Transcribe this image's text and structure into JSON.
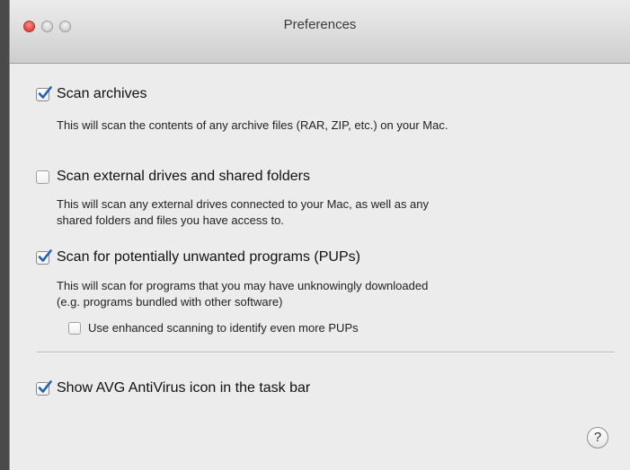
{
  "window": {
    "title": "Preferences"
  },
  "options": [
    {
      "label": "Scan archives",
      "checked": true,
      "description": "This will scan the contents of any archive files (RAR, ZIP, etc.) on your Mac."
    },
    {
      "label": "Scan external drives and shared folders",
      "checked": false,
      "description_line1": "This will scan any external drives connected to your Mac, as well as any",
      "description_line2": "shared folders and files you have access to."
    },
    {
      "label": "Scan for potentially unwanted programs (PUPs)",
      "checked": true,
      "description_line1": "This will scan for programs that you may have unknowingly downloaded",
      "description_line2": "(e.g. programs bundled with other software)",
      "sub_option": {
        "label": "Use enhanced scanning to identify even more PUPs",
        "checked": false
      }
    },
    {
      "label": "Show AVG AntiVirus icon in the task bar",
      "checked": true
    }
  ],
  "help": {
    "label": "?"
  }
}
